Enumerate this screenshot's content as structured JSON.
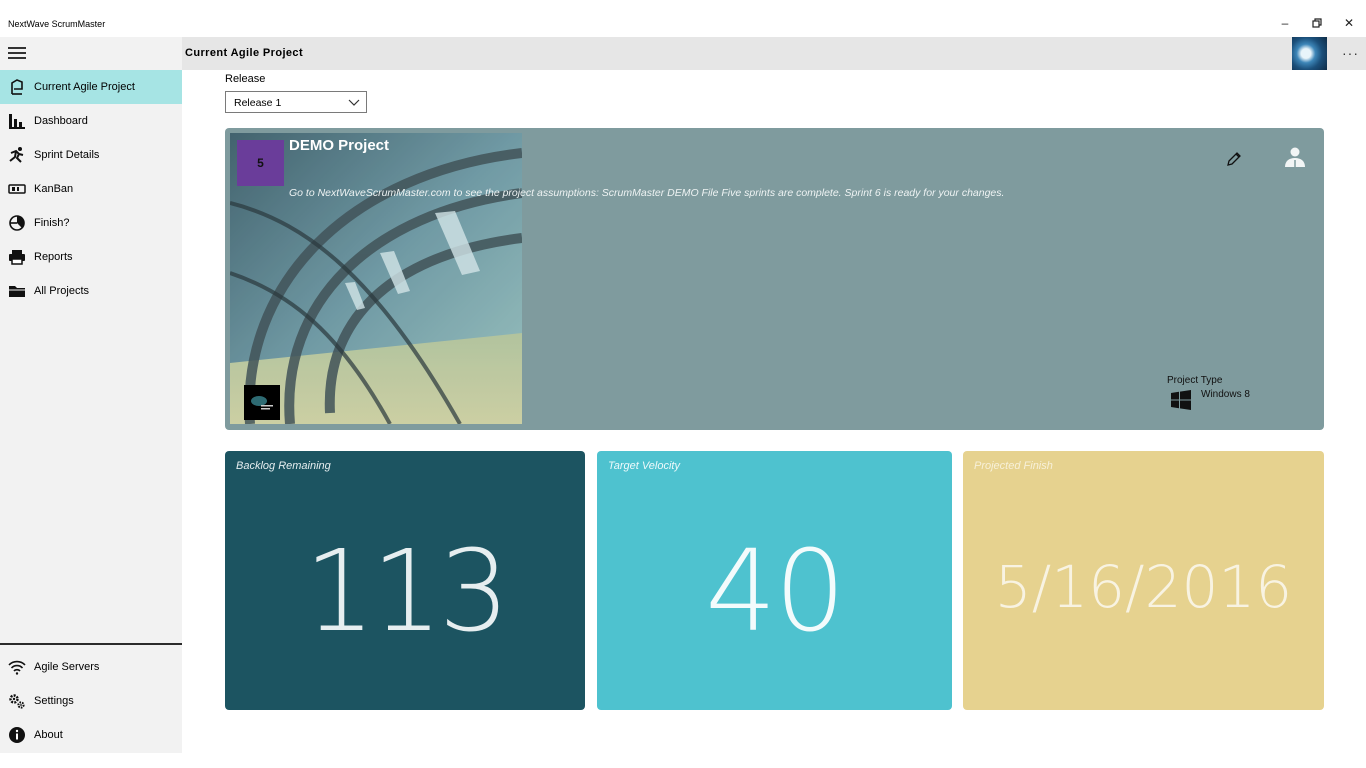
{
  "window": {
    "title": "NextWave ScrumMaster",
    "minimize_glyph": "–",
    "restore_glyph": "❐",
    "close_glyph": "✕"
  },
  "header": {
    "title": "Current Agile Project",
    "more_glyph": "···"
  },
  "sidebar": {
    "items": [
      {
        "label": "Current Agile Project",
        "icon": "flag-icon",
        "active": true
      },
      {
        "label": "Dashboard",
        "icon": "bar-chart-icon"
      },
      {
        "label": "Sprint Details",
        "icon": "runner-icon"
      },
      {
        "label": "KanBan",
        "icon": "kanban-icon"
      },
      {
        "label": "Finish?",
        "icon": "pie-chart-icon"
      },
      {
        "label": "Reports",
        "icon": "printer-icon"
      },
      {
        "label": "All Projects",
        "icon": "folder-icon"
      }
    ],
    "bottom_items": [
      {
        "label": "Agile Servers",
        "icon": "wifi-icon"
      },
      {
        "label": "Settings",
        "icon": "gears-icon"
      },
      {
        "label": "About",
        "icon": "info-icon"
      }
    ]
  },
  "release": {
    "label": "Release",
    "selected": "Release 1"
  },
  "project": {
    "sprint_number": "5",
    "name": "DEMO Project",
    "description": "Go to NextWaveScrumMaster.com to see the project assumptions: ScrumMaster DEMO File  Five sprints are complete.  Sprint 6 is ready for your changes.",
    "type_label": "Project Type",
    "type_value": "Windows 8"
  },
  "tiles": {
    "backlog": {
      "label": "Backlog Remaining",
      "value": "113"
    },
    "velocity": {
      "label": "Target Velocity",
      "value": "40"
    },
    "finish": {
      "label": "Projected Finish",
      "value": "5/16/2016"
    }
  },
  "colors": {
    "nav_active": "#a6e4e4",
    "project_card": "#7f9b9e",
    "sprint_badge": "#6a3d9a",
    "backlog_tile": "#1c5461",
    "velocity_tile": "#4ec2cf",
    "finish_tile": "#e6d28f"
  }
}
